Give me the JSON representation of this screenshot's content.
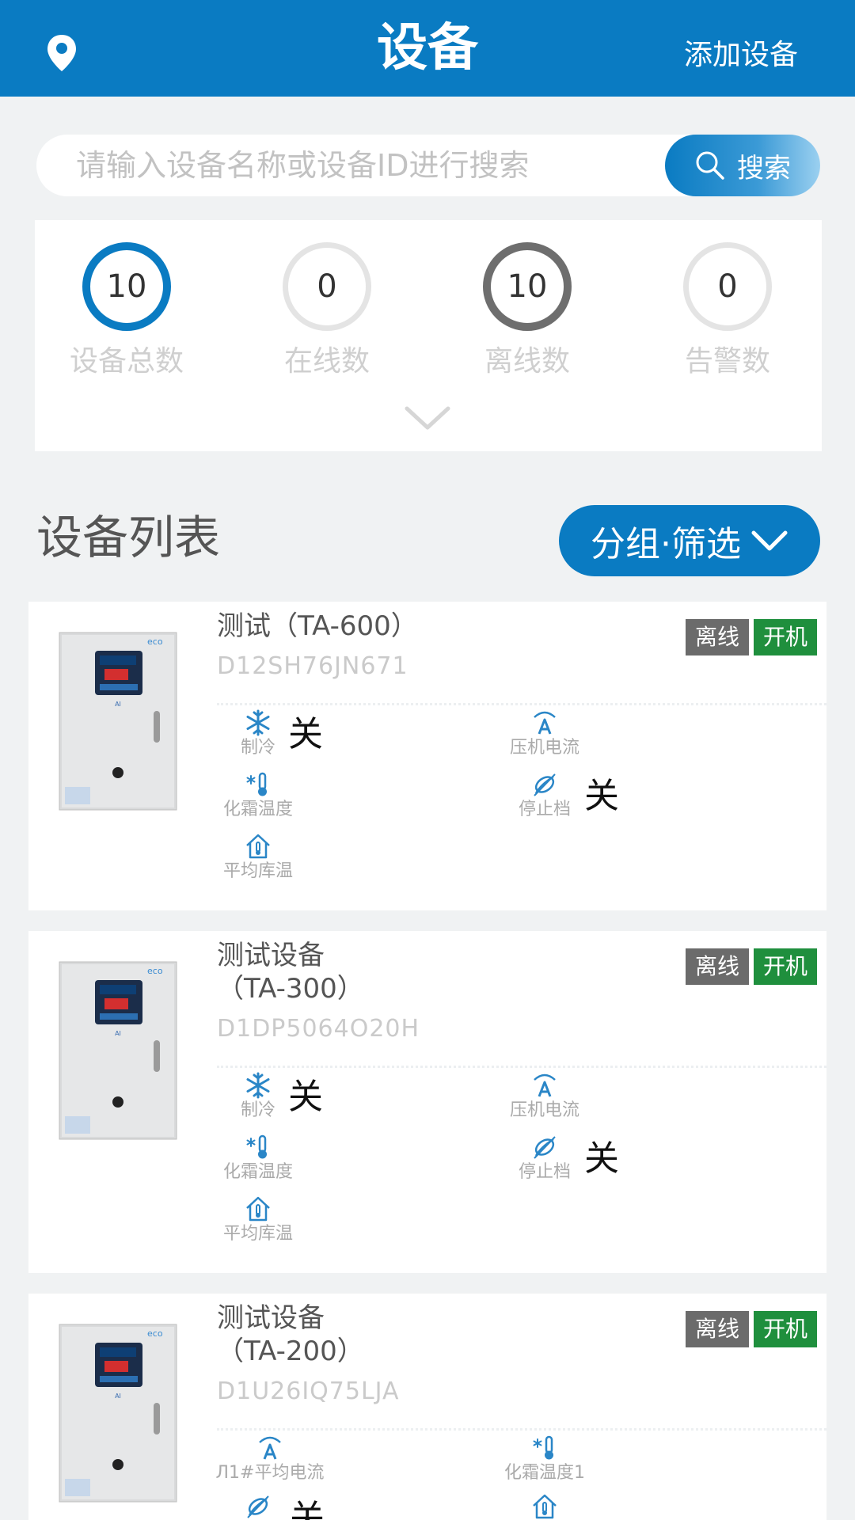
{
  "header": {
    "title": "设备",
    "add_label": "添加设备",
    "icon": "location-pin-icon"
  },
  "search": {
    "placeholder": "请输入设备名称或设备ID进行搜索",
    "button_label": "搜索",
    "icon": "search-icon"
  },
  "stats": [
    {
      "value": "10",
      "label": "设备总数",
      "ring_color": "#0a7bc2"
    },
    {
      "value": "0",
      "label": "在线数",
      "ring_color": "#e6e6e6"
    },
    {
      "value": "10",
      "label": "离线数",
      "ring_color": "#6e6e6e"
    },
    {
      "value": "0",
      "label": "告警数",
      "ring_color": "#e6e6e6"
    }
  ],
  "list": {
    "title": "设备列表",
    "filter_label": "分组·筛选"
  },
  "devices": [
    {
      "name": "测试（TA-600）",
      "id": "D12SH76JN671",
      "status": "离线",
      "power": "开机",
      "metrics": [
        {
          "label": "制冷",
          "icon": "snowflake-icon",
          "value": "关"
        },
        {
          "label": "压机电流",
          "icon": "current-icon",
          "value": ""
        },
        {
          "label": "化霜温度",
          "icon": "defrost-thermometer-icon",
          "value": ""
        },
        {
          "label": "停止档",
          "icon": "fan-icon",
          "value": "关"
        },
        {
          "label": "平均库温",
          "icon": "house-thermometer-icon",
          "value": ""
        }
      ]
    },
    {
      "name": "测试设备\n（TA-300）",
      "id": "D1DP5064O20H",
      "status": "离线",
      "power": "开机",
      "metrics": [
        {
          "label": "制冷",
          "icon": "snowflake-icon",
          "value": "关"
        },
        {
          "label": "压机电流",
          "icon": "current-icon",
          "value": ""
        },
        {
          "label": "化霜温度",
          "icon": "defrost-thermometer-icon",
          "value": ""
        },
        {
          "label": "停止档",
          "icon": "fan-icon",
          "value": "关"
        },
        {
          "label": "平均库温",
          "icon": "house-thermometer-icon",
          "value": ""
        }
      ]
    },
    {
      "name": "测试设备\n（TA-200）",
      "id": "D1U26IQ75LJA",
      "status": "离线",
      "power": "开机",
      "metrics": [
        {
          "label": "Л1#平均电流",
          "icon": "current-icon",
          "value": ""
        },
        {
          "label": "化霜温度1",
          "icon": "defrost-thermometer-icon",
          "value": ""
        },
        {
          "label": "",
          "icon": "fan-icon",
          "value": "关"
        },
        {
          "label": "",
          "icon": "house-thermometer-icon",
          "value": ""
        }
      ]
    }
  ],
  "colors": {
    "primary": "#0a7bc2",
    "offline": "#6b6b6b",
    "power_on": "#1f8f3d"
  }
}
